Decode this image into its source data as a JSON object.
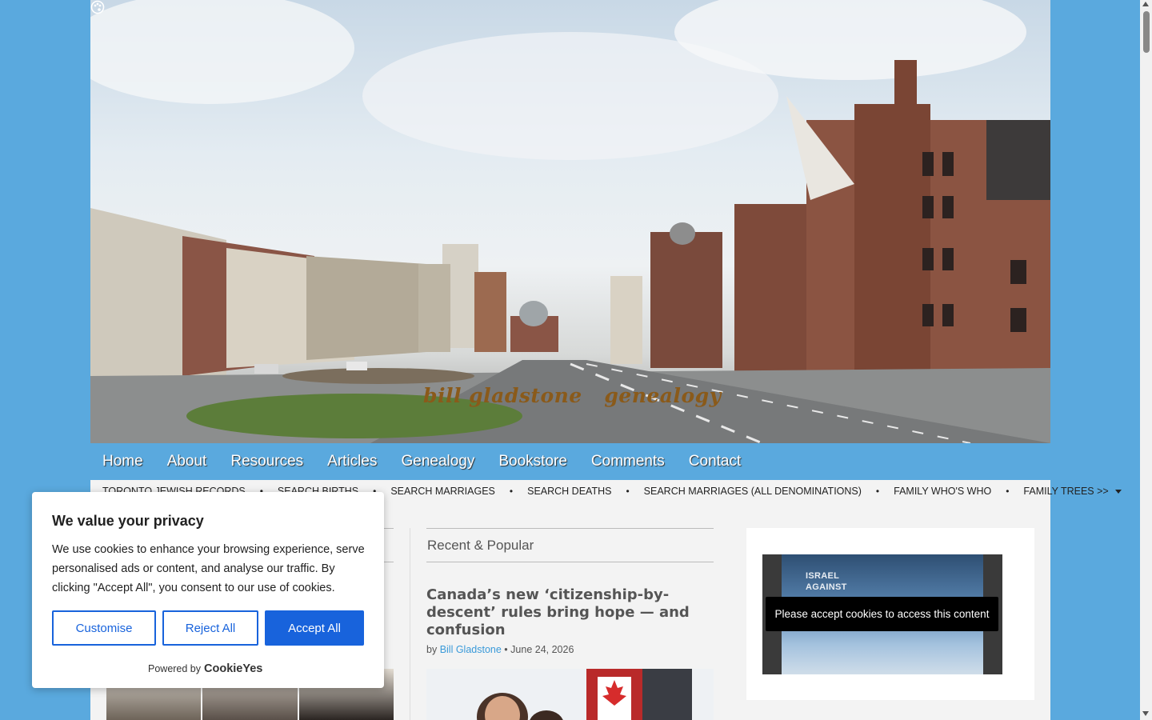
{
  "header": {
    "site_title": "bill gladstone   genealogy"
  },
  "main_nav": [
    "Home",
    "About",
    "Resources",
    "Articles",
    "Genealogy",
    "Bookstore",
    "Comments",
    "Contact"
  ],
  "sub_nav": {
    "items": [
      "TORONTO JEWISH RECORDS",
      "SEARCH BIRTHS",
      "SEARCH MARRIAGES",
      "SEARCH DEATHS",
      "SEARCH MARRIAGES (ALL DENOMINATIONS)",
      "FAMILY WHO'S WHO",
      "FAMILY TREES >>"
    ],
    "separator": "•"
  },
  "recent": {
    "section_title": "Recent & Popular",
    "post_title": "Canada’s new ‘citizenship-by-descent’ rules bring hope — and confusion",
    "by": "by",
    "author": "Bill Gladstone",
    "dot": "•",
    "date": "June 24, 2026"
  },
  "sidebar": {
    "video_text_1": "ISRAEL",
    "video_text_2": "AGAINST",
    "cookie_message": "Please accept cookies to access this content"
  },
  "cookie_banner": {
    "title": "We value your privacy",
    "text": "We use cookies to enhance your browsing experience, serve personalised ads or content, and analyse our traffic. By clicking \"Accept All\", you consent to our use of cookies.",
    "customise": "Customise",
    "reject": "Reject All",
    "accept": "Accept All",
    "powered_by": "Powered by",
    "brand": "CookieYes",
    "accent_color": "#1863dc"
  },
  "colors": {
    "background": "#5aa9de",
    "nav": "#5aa9de",
    "link": "#3a9ad9"
  }
}
